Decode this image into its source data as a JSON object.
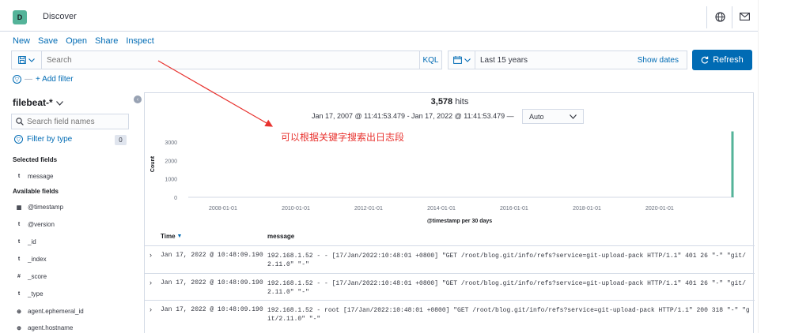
{
  "header": {
    "logo_letter": "D",
    "title": "Discover",
    "icons": [
      "help-globe-icon",
      "mail-icon"
    ]
  },
  "top_nav": [
    "New",
    "Save",
    "Open",
    "Share",
    "Inspect"
  ],
  "query_bar": {
    "placeholder": "Search",
    "language": "KQL"
  },
  "date_picker": {
    "range": "Last 15 years",
    "show_dates_label": "Show dates"
  },
  "refresh_label": "Refresh",
  "filter_bar": {
    "separator": "—",
    "add_filter_label": "+ Add filter"
  },
  "sidebar": {
    "index_pattern": "filebeat-*",
    "search_placeholder": "Search field names",
    "filter_by_type_label": "Filter by type",
    "filter_by_type_count": "0",
    "selected_fields_title": "Selected fields",
    "selected_fields": [
      {
        "type": "t",
        "name": "message"
      }
    ],
    "available_fields_title": "Available fields",
    "available_fields": [
      {
        "type": "▦",
        "name": "@timestamp"
      },
      {
        "type": "t",
        "name": "@version"
      },
      {
        "type": "t",
        "name": "_id"
      },
      {
        "type": "t",
        "name": "_index"
      },
      {
        "type": "#",
        "name": "_score"
      },
      {
        "type": "t",
        "name": "_type"
      },
      {
        "type": "⊕",
        "name": "agent.ephemeral_id"
      },
      {
        "type": "⊕",
        "name": "agent.hostname"
      }
    ]
  },
  "results": {
    "hits_count": "3,578",
    "hits_label": "hits",
    "time_range": "Jan 17, 2007 @ 11:41:53.479 - Jan 17, 2022 @ 11:41:53.479 —",
    "interval": "Auto"
  },
  "chart_data": {
    "type": "bar",
    "ylabel": "Count",
    "xlabel": "@timestamp per 30 days",
    "ylim": [
      0,
      3600
    ],
    "y_ticks": [
      "3000",
      "2000",
      "1000",
      "0"
    ],
    "x_ticks": [
      "2008-01-01",
      "2010-01-01",
      "2012-01-01",
      "2014-01-01",
      "2016-01-01",
      "2018-01-01",
      "2020-01-01"
    ],
    "bars": [
      {
        "x": "2022-01-01",
        "value": 3578
      }
    ],
    "bar_color": "#54b399"
  },
  "table": {
    "columns": [
      "Time",
      "message"
    ],
    "rows": [
      {
        "time": "Jan 17, 2022 @ 10:48:09.190",
        "message": "192.168.1.52 - - [17/Jan/2022:10:48:01 +0800] \"GET /root/blog.git/info/refs?service=git-upload-pack HTTP/1.1\" 401 26 \"-\" \"git/2.11.0\" \"-\""
      },
      {
        "time": "Jan 17, 2022 @ 10:48:09.190",
        "message": "192.168.1.52 - - [17/Jan/2022:10:48:01 +0800] \"GET /root/blog.git/info/refs?service=git-upload-pack HTTP/1.1\" 401 26 \"-\" \"git/2.11.0\" \"-\""
      },
      {
        "time": "Jan 17, 2022 @ 10:48:09.190",
        "message": "192.168.1.52 - root [17/Jan/2022:10:48:01 +0800] \"GET /root/blog.git/info/refs?service=git-upload-pack HTTP/1.1\" 200 318 \"-\" \"git/2.11.0\" \"-\""
      }
    ]
  },
  "annotation": {
    "text": "可以根据关键字搜索出日志段",
    "color": "#e8322e"
  }
}
